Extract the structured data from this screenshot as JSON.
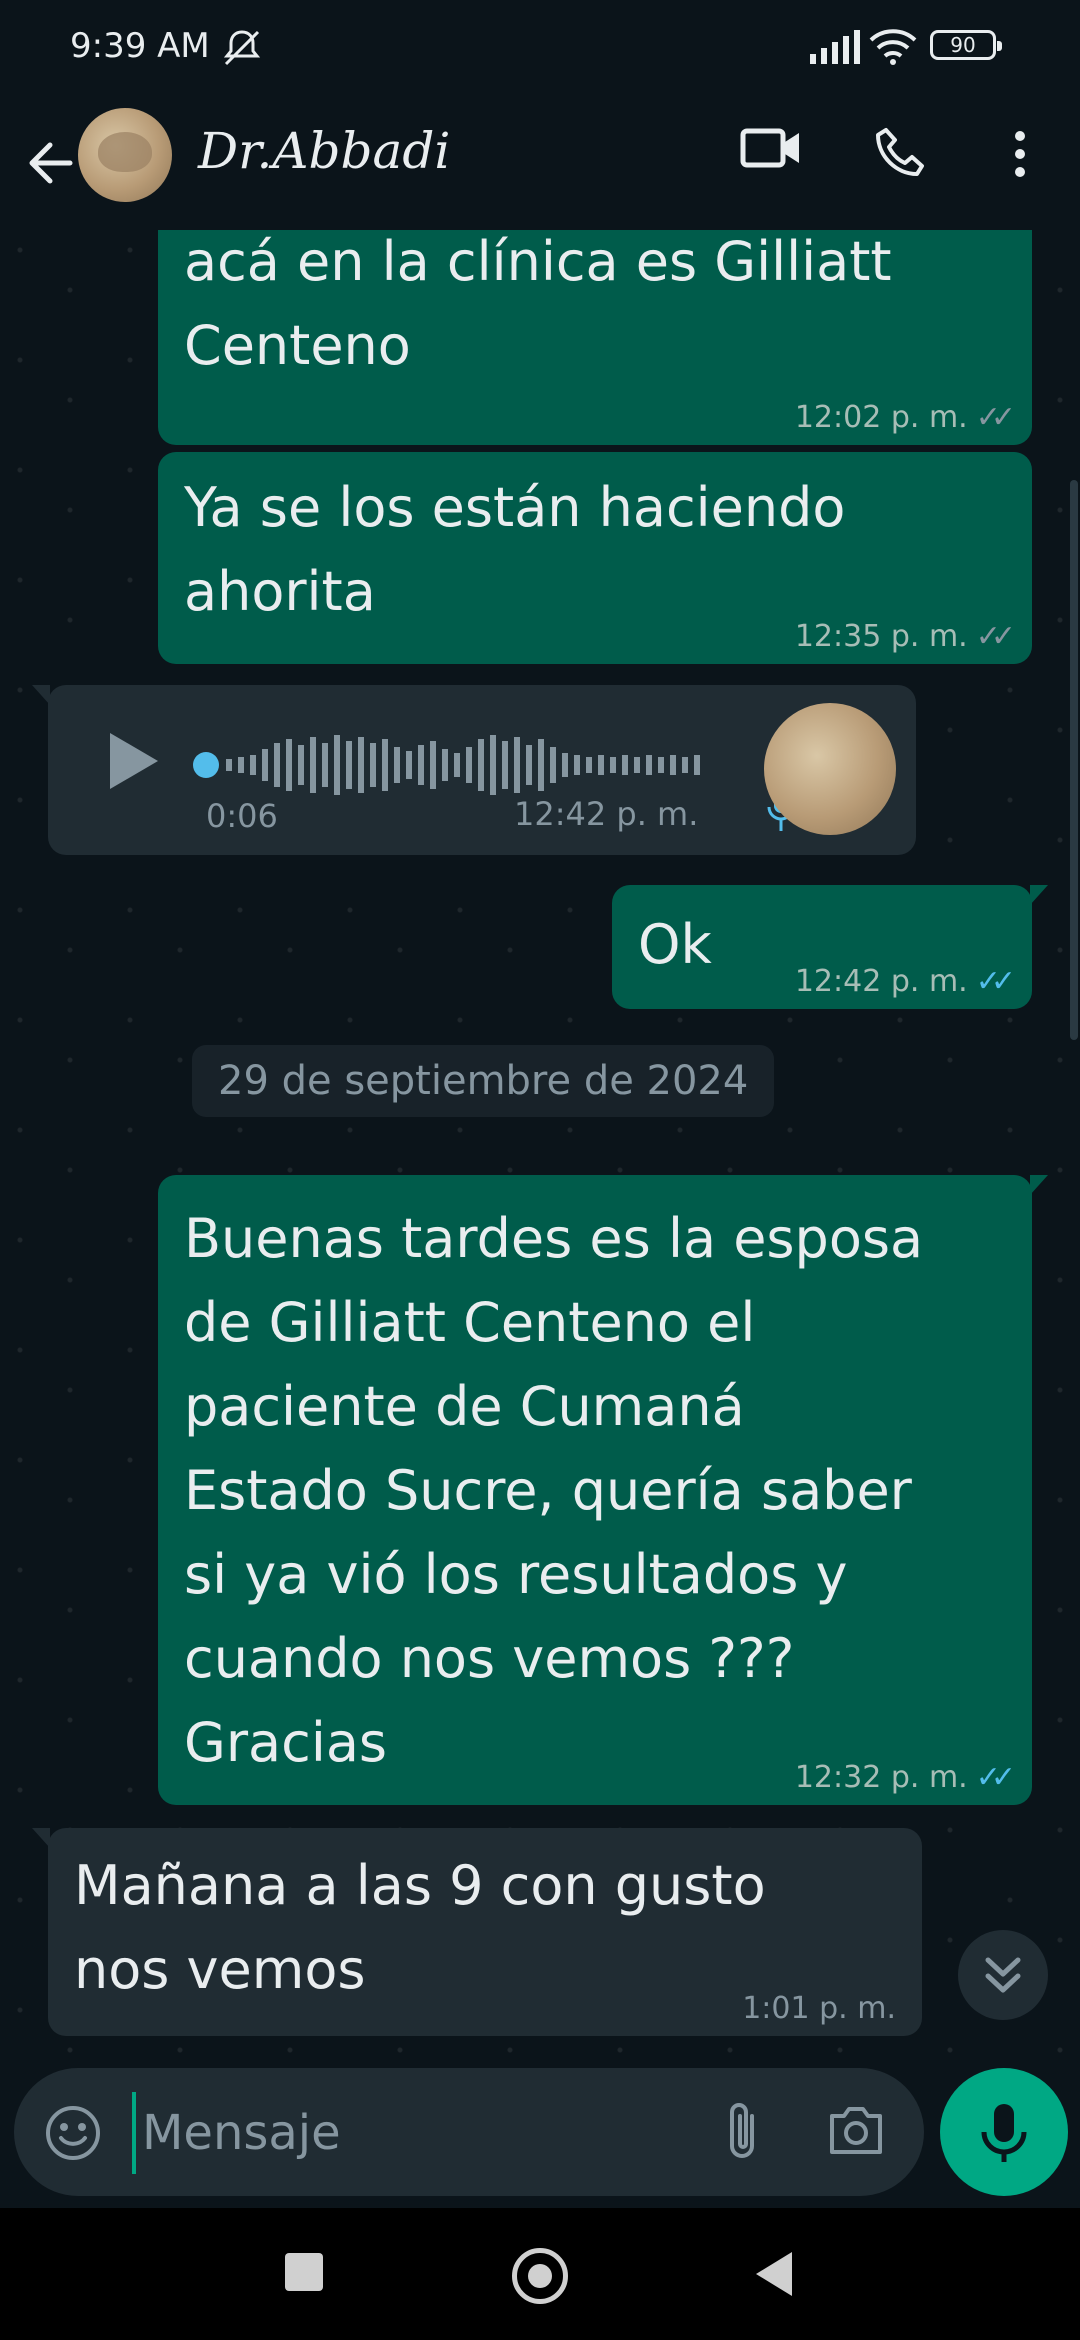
{
  "status_bar": {
    "time": "9:39 AM",
    "battery": "90"
  },
  "header": {
    "contact_name": "Dr.Abbadi",
    "icons": [
      "back-arrow-icon",
      "video-call-icon",
      "phone-icon",
      "more-vert-icon"
    ]
  },
  "messages": [
    {
      "type": "outgoing",
      "partial_top_text": "acá en la clínica es Gilliatt",
      "text_line2": "Centeno",
      "time": "12:02 p. m.",
      "status": "delivered"
    },
    {
      "type": "outgoing",
      "text_line1": "Ya se los están haciendo",
      "text_line2": "ahorita",
      "time": "12:35 p. m.",
      "status": "delivered"
    },
    {
      "type": "incoming-voice",
      "duration": "0:06",
      "time": "12:42 p. m."
    },
    {
      "type": "outgoing",
      "text": "Ok",
      "time": "12:42 p. m.",
      "status": "read"
    }
  ],
  "date_separator": "29 de septiembre de 2024",
  "messages_after": [
    {
      "type": "outgoing",
      "lines": [
        "Buenas tardes es la esposa",
        "de Gilliatt Centeno el",
        "paciente de Cumaná",
        "Estado Sucre, quería saber",
        "si ya vió los resultados y",
        "cuando nos vemos ???",
        "Gracias"
      ],
      "time": "12:32 p. m.",
      "status": "read"
    },
    {
      "type": "incoming",
      "lines": [
        "Mañana a las 9 con gusto",
        "nos vemos"
      ],
      "time": "1:01 p. m."
    }
  ],
  "input": {
    "placeholder": "Mensaje"
  },
  "colors": {
    "background": "#0b141a",
    "outgoing_bubble": "#005c4b",
    "incoming_bubble": "#202c33",
    "accent": "#00a884",
    "read_ticks": "#53bdeb"
  }
}
